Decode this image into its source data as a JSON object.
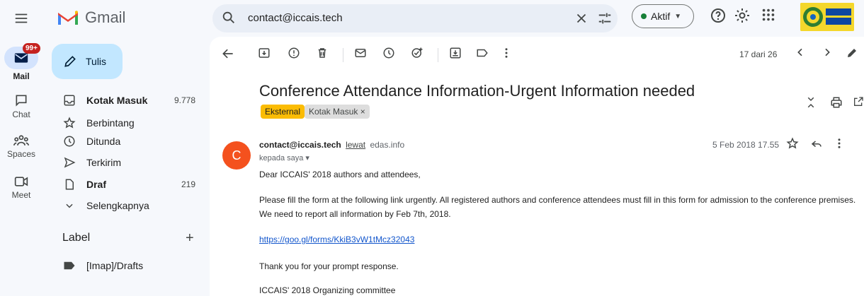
{
  "app": {
    "name": "Gmail"
  },
  "search": {
    "value": "contact@iccais.tech"
  },
  "status": {
    "label": "Aktif"
  },
  "rail": {
    "mail_label": "Mail",
    "mail_badge": "99+",
    "chat_label": "Chat",
    "spaces_label": "Spaces",
    "meet_label": "Meet"
  },
  "compose": {
    "label": "Tulis"
  },
  "nav": [
    {
      "label": "Kotak Masuk",
      "count": "9.778",
      "icon": "inbox-icon"
    },
    {
      "label": "Berbintang",
      "count": "",
      "icon": "star-icon"
    },
    {
      "label": "Ditunda",
      "count": "",
      "icon": "clock-icon"
    },
    {
      "label": "Terkirim",
      "count": "",
      "icon": "send-icon"
    },
    {
      "label": "Draf",
      "count": "219",
      "icon": "draft-icon"
    },
    {
      "label": "Selengkapnya",
      "count": "",
      "icon": "chevron-down-icon"
    }
  ],
  "labels": {
    "heading": "Label",
    "items": [
      "[Imap]/Drafts"
    ]
  },
  "toolbar": {
    "page_count": "17 dari 26"
  },
  "message": {
    "subject": "Conference Attendance Information-Urgent Information needed",
    "tags": [
      "Eksternal",
      "Kotak Masuk ×"
    ],
    "avatar_letter": "C",
    "sender_email": "contact@iccais.tech",
    "sender_via": "lewat",
    "sender_domain": "edas.info",
    "to": "kepada saya ▾",
    "date": "5 Feb 2018 17.55",
    "greeting": "Dear ICCAIS' 2018 authors and attendees,",
    "para1_line1": "Please fill the form at the following link urgently. All registered authors and conference attendees must fill in this form for admission to the conference premises.",
    "para1_line2": "We need to report all information by Feb 7th, 2018.",
    "link": "https://goo.gl/forms/KkiB3vW1tMcz32043",
    "thanks": "Thank you for your prompt response.",
    "signature": "ICCAIS' 2018 Organizing committee"
  }
}
